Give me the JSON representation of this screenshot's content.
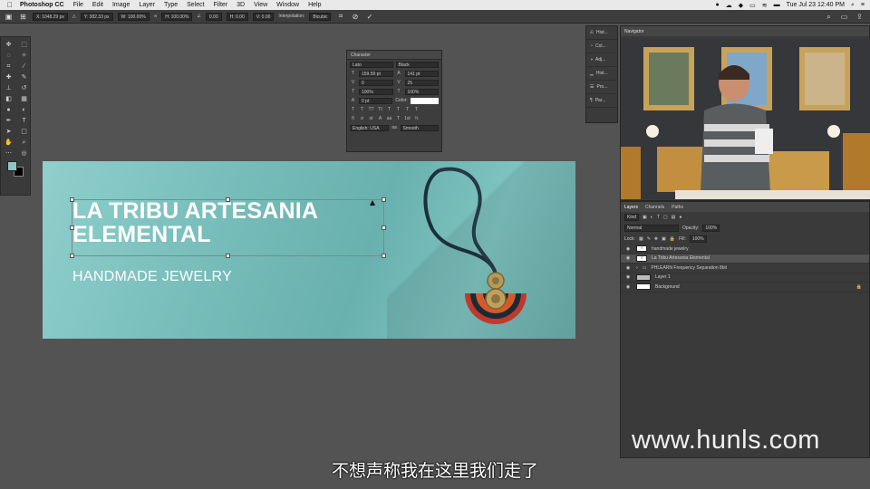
{
  "menubar": {
    "app_name": "Photoshop CC",
    "items": [
      "File",
      "Edit",
      "Image",
      "Layer",
      "Type",
      "Select",
      "Filter",
      "3D",
      "View",
      "Window",
      "Help"
    ],
    "clock": "Tue Jul 23  12:40 PM"
  },
  "options_bar": {
    "x": "X: 1048.29 px",
    "y": "Y: 382.33 px",
    "w": "W: 100.00%",
    "h": "H: 100.00%",
    "angle": "0.00",
    "hskew": "H: 0.00",
    "vskew": "V: 0.00",
    "interp_label": "Interpolation:",
    "interp_value": "Bicubic"
  },
  "canvas": {
    "headline_line1": "LA TRIBU ARTESANIA",
    "headline_line2": "ELEMENTAL",
    "subhead": "HANDMADE JEWELRY"
  },
  "character_panel": {
    "title": "Character",
    "font_family": "Lato",
    "font_style": "Black",
    "size": "159.59 pt",
    "leading": "141 pt",
    "kerning": "0",
    "tracking": "25",
    "vscale": "100%",
    "hscale": "100%",
    "baseline": "0 pt",
    "color_label": "Color:",
    "language": "English: USA",
    "aa_label": "aa",
    "antialias": "Smooth"
  },
  "side_strip": {
    "items": [
      "Hist...",
      "Col...",
      "Adj...",
      "Hist...",
      "Pro...",
      "Par..."
    ]
  },
  "navigator": {
    "title": "Navigator"
  },
  "layers_panel": {
    "tabs": [
      "Layers",
      "Channels",
      "Paths"
    ],
    "filter": "Kind",
    "blend_mode": "Normal",
    "opacity_label": "Opacity:",
    "opacity": "100%",
    "lock_label": "Lock:",
    "fill_label": "Fill:",
    "fill": "100%",
    "layers": [
      {
        "name": "handmade jewelry",
        "thumb": "T",
        "selected": false
      },
      {
        "name": "La Tribu Artesania  Elemental",
        "thumb": "T",
        "selected": true
      },
      {
        "name": "PHLEARN Frequency Separation 8bit",
        "thumb": "",
        "selected": false
      },
      {
        "name": "Layer 1",
        "thumb": "",
        "selected": false
      },
      {
        "name": "Background",
        "thumb": "",
        "selected": false
      }
    ]
  },
  "watermark": "www.hunls.com",
  "subtitle": "不想声称我在这里我们走了",
  "colors": {
    "canvas_teal": "#7ec4c1",
    "foreground_swatch": "#8dc7c4",
    "ui_dark": "#535353"
  }
}
